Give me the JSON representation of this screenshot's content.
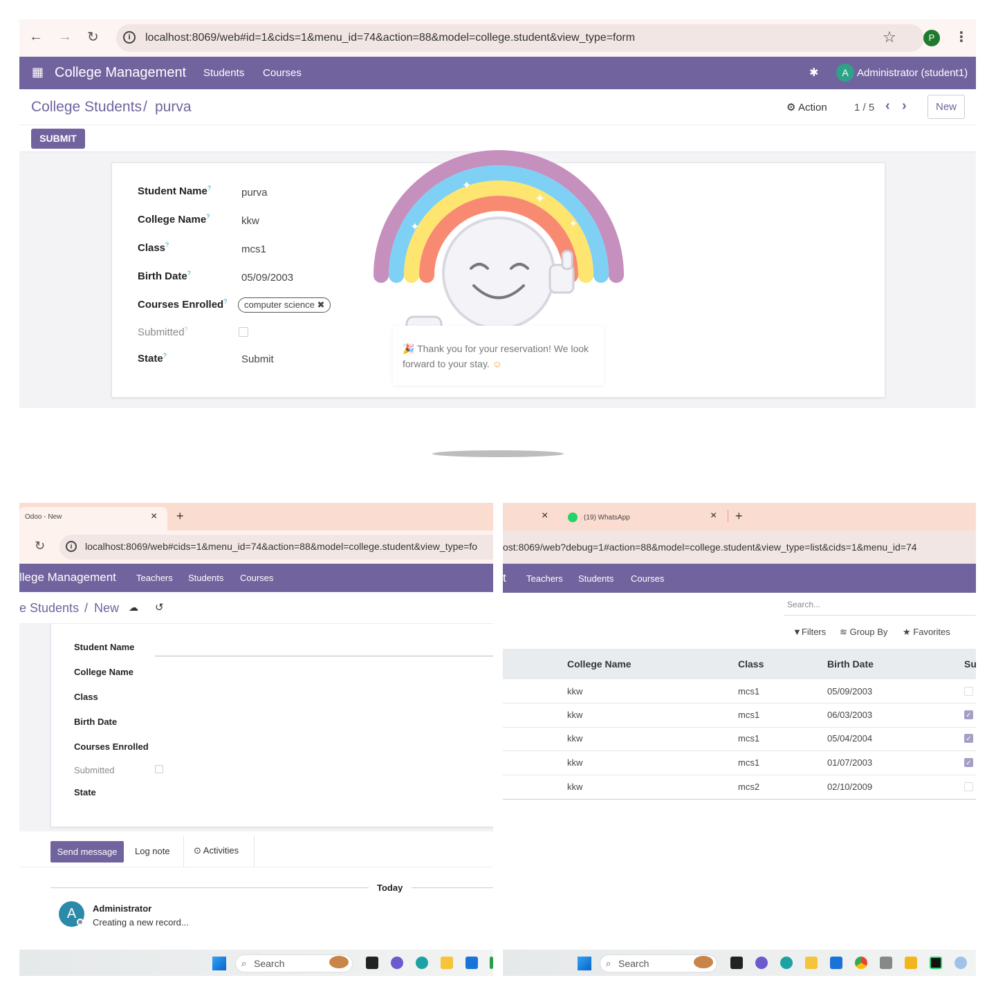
{
  "top": {
    "url": "localhost:8069/web#id=1&cids=1&menu_id=74&action=88&model=college.student&view_type=form",
    "profile_initial": "P",
    "app_name": "College Management",
    "menu": [
      "Students",
      "Courses"
    ],
    "user_initial": "A",
    "user_name": "Administrator (student1)",
    "breadcrumb_parent": "College Students",
    "breadcrumb_sep": "/",
    "breadcrumb_current": "purva",
    "action_label": "Action",
    "pager": "1 / 5",
    "new_label": "New",
    "submit_label": "SUBMIT",
    "fields": [
      {
        "label": "Student Name",
        "value": "purva"
      },
      {
        "label": "College Name",
        "value": "kkw"
      },
      {
        "label": "Class",
        "value": "mcs1"
      },
      {
        "label": "Birth Date",
        "value": "05/09/2003"
      },
      {
        "label": "Courses Enrolled",
        "value": "computer science"
      },
      {
        "label": "Submitted",
        "value": ""
      },
      {
        "label": "State",
        "value": "Submit"
      }
    ],
    "help_mark": "?",
    "tag_remove": "✖",
    "rainbow_message": "Thank you for your reservation! We look forward to your stay."
  },
  "bottom_left": {
    "tab_title": "Odoo - New",
    "tab_close": "×",
    "tab_add": "+",
    "url": "localhost:8069/web#cids=1&menu_id=74&action=88&model=college.student&view_type=fo",
    "app_name": "llege Management",
    "menu": [
      "Teachers",
      "Students",
      "Courses"
    ],
    "breadcrumb_parent": "e Students",
    "breadcrumb_sep": "/",
    "breadcrumb_current": "New",
    "fields": [
      "Student Name",
      "College Name",
      "Class",
      "Birth Date",
      "Courses Enrolled",
      "Submitted",
      "State"
    ],
    "chatter": {
      "send_message": "Send message",
      "log_note": "Log note",
      "activities": "Activities",
      "today": "Today",
      "author": "Administrator",
      "message": "Creating a new record...",
      "avatar_initial": "A"
    },
    "taskbar_search": "Search"
  },
  "bottom_right": {
    "tab_close": "×",
    "tab2_title": "(19) WhatsApp",
    "tab2_close": "×",
    "tab_add": "+",
    "url": "ost:8069/web?debug=1#action=88&model=college.student&view_type=list&cids=1&menu_id=74",
    "app_name_fragment": "t",
    "menu": [
      "Teachers",
      "Students",
      "Courses"
    ],
    "search_placeholder": "Search...",
    "filters": "Filters",
    "group_by": "Group By",
    "favorites": "Favorites",
    "columns": [
      "College Name",
      "Class",
      "Birth Date",
      "Sul"
    ],
    "rows": [
      {
        "college": "kkw",
        "class": "mcs1",
        "birth": "05/09/2003",
        "submitted": false
      },
      {
        "college": "kkw",
        "class": "mcs1",
        "birth": "06/03/2003",
        "submitted": true
      },
      {
        "college": "kkw",
        "class": "mcs1",
        "birth": "05/04/2004",
        "submitted": true
      },
      {
        "college": "kkw",
        "class": "mcs1",
        "birth": "01/07/2003",
        "submitted": true
      },
      {
        "college": "kkw",
        "class": "mcs2",
        "birth": "02/10/2009",
        "submitted": false
      }
    ],
    "taskbar_search": "Search"
  },
  "colors": {
    "odoo_purple": "#71639e",
    "tab_peach": "#fbdcd0",
    "rainbow_violet": "#c58fbe",
    "rainbow_blue": "#7fd0f5",
    "rainbow_yellow": "#fde56f",
    "rainbow_coral": "#f98a72"
  }
}
